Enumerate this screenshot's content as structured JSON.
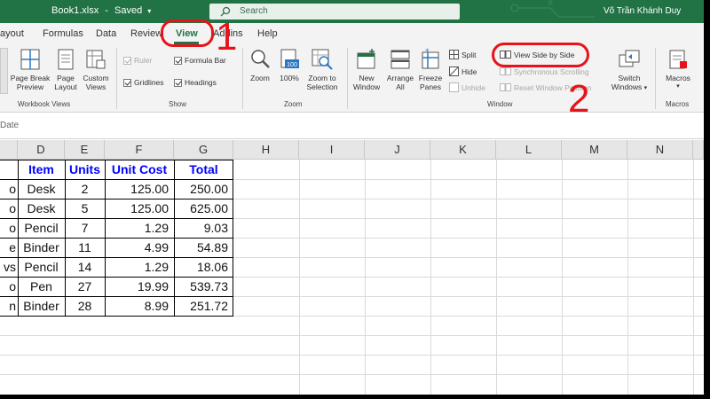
{
  "titlebar": {
    "doc_title": "Book1.xlsx",
    "separator": "-",
    "save_status": "Saved",
    "search_placeholder": "Search",
    "user_name": "Võ Trần Khánh Duy"
  },
  "tabs": [
    {
      "label": "ayout"
    },
    {
      "label": "Formulas"
    },
    {
      "label": "Data"
    },
    {
      "label": "Review"
    },
    {
      "label": "View",
      "active": true
    },
    {
      "label": "Addins"
    },
    {
      "label": "Help"
    }
  ],
  "ribbon": {
    "workbook_views": {
      "label": "Workbook Views",
      "page_break_preview": "Page Break\nPreview",
      "page_layout": "Page\nLayout",
      "custom_views": "Custom\nViews"
    },
    "show": {
      "label": "Show",
      "ruler": "Ruler",
      "formula_bar": "Formula Bar",
      "gridlines": "Gridlines",
      "headings": "Headings"
    },
    "zoom": {
      "label": "Zoom",
      "zoom": "Zoom",
      "zoom_100": "100%",
      "zoom_to_selection": "Zoom to\nSelection"
    },
    "window": {
      "label": "Window",
      "new_window": "New\nWindow",
      "arrange_all": "Arrange\nAll",
      "freeze_panes": "Freeze\nPanes",
      "split": "Split",
      "hide": "Hide",
      "unhide": "Unhide",
      "view_side_by_side": "View Side by Side",
      "synchronous_scrolling": "Synchronous Scrolling",
      "reset_window_position": "Reset Window Position",
      "switch_windows": "Switch\nWindows"
    },
    "macros": {
      "label": "Macros",
      "macros": "Macros"
    }
  },
  "formula_bar": {
    "partial_text": "Date"
  },
  "sheet": {
    "columns": [
      "D",
      "E",
      "F",
      "G",
      "H",
      "I",
      "J",
      "K",
      "L",
      "M",
      "N"
    ],
    "table_headers": {
      "item": "Item",
      "units": "Units",
      "unit_cost": "Unit Cost",
      "total": "Total"
    },
    "rows": [
      {
        "c": "o",
        "item": "Desk",
        "units": "2",
        "unit_cost": "125.00",
        "total": "250.00"
      },
      {
        "c": "o",
        "item": "Desk",
        "units": "5",
        "unit_cost": "125.00",
        "total": "625.00"
      },
      {
        "c": "o",
        "item": "Pencil",
        "units": "7",
        "unit_cost": "1.29",
        "total": "9.03"
      },
      {
        "c": "e",
        "item": "Binder",
        "units": "11",
        "unit_cost": "4.99",
        "total": "54.89"
      },
      {
        "c": "vs",
        "item": "Pencil",
        "units": "14",
        "unit_cost": "1.29",
        "total": "18.06"
      },
      {
        "c": "o",
        "item": "Pen",
        "units": "27",
        "unit_cost": "19.99",
        "total": "539.73"
      },
      {
        "c": "n",
        "item": "Binder",
        "units": "28",
        "unit_cost": "8.99",
        "total": "251.72"
      }
    ]
  },
  "annotations": {
    "step1": "1",
    "step2": "2"
  },
  "colors": {
    "brand": "#217346",
    "annotation": "#e8121a",
    "header_text": "#0000ff"
  }
}
